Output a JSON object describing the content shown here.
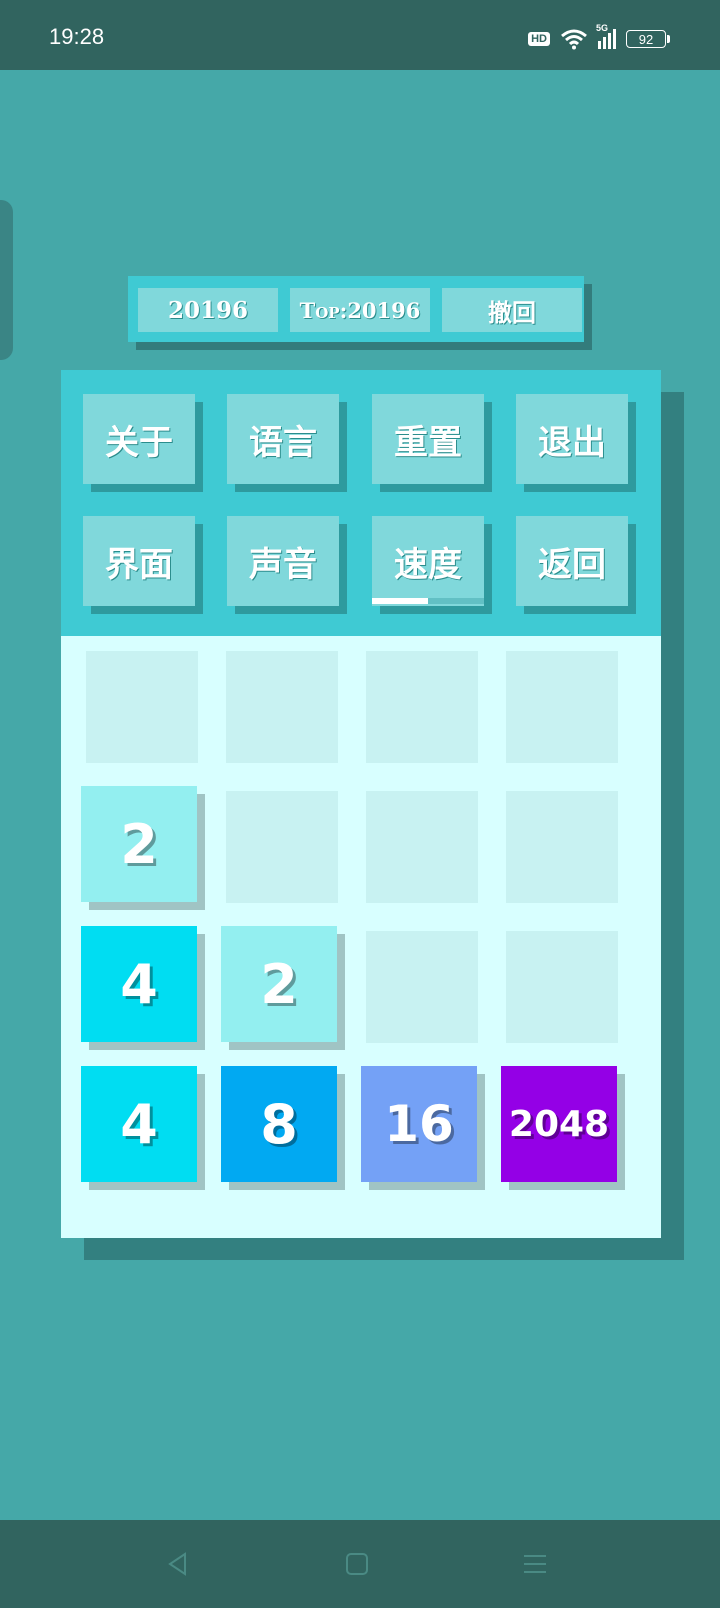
{
  "status": {
    "time": "19:28",
    "hd": "HD",
    "network": "5G",
    "battery": "92"
  },
  "topbar": {
    "score": "20196",
    "best": "Top:20196",
    "undo": "撤回"
  },
  "menu": {
    "about": "关于",
    "language": "语言",
    "reset": "重置",
    "quit": "退出",
    "theme": "界面",
    "sound": "声音",
    "speed": "速度",
    "back": "返回",
    "speed_level": 0.5
  },
  "board": {
    "rows": [
      [
        "",
        "",
        "",
        ""
      ],
      [
        "2",
        "",
        "",
        ""
      ],
      [
        "4",
        "2",
        "",
        ""
      ],
      [
        "4",
        "8",
        "16",
        "2048"
      ]
    ],
    "tile_colors": {
      "2": "#93eff0",
      "4": "#00ddf2",
      "8": "#01a9f2",
      "16": "#74a1f6",
      "2048": "#9400e6"
    }
  },
  "nav": {
    "back": "back-triangle",
    "home": "home-square",
    "menu": "menu-lines"
  }
}
